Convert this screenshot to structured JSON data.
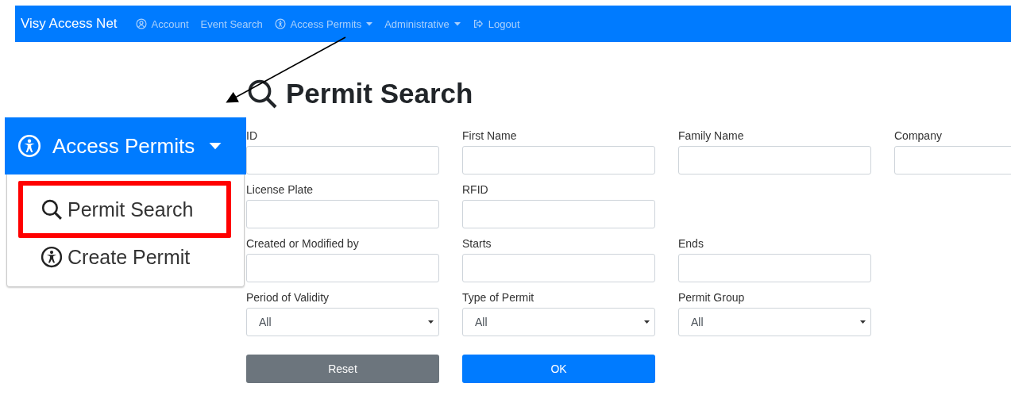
{
  "navbar": {
    "brand": "Visy Access Net",
    "items": [
      {
        "label": "Account",
        "dropdown": false
      },
      {
        "label": "Event Search",
        "dropdown": false
      },
      {
        "label": "Access Permits",
        "dropdown": true
      },
      {
        "label": "Administrative",
        "dropdown": true
      },
      {
        "label": "Logout",
        "dropdown": false
      }
    ]
  },
  "inset": {
    "header": {
      "label": "Access Permits",
      "dropdown": true
    },
    "items": [
      {
        "label": "Permit Search",
        "highlighted": true
      },
      {
        "label": "Create Permit",
        "highlighted": false
      }
    ]
  },
  "page": {
    "title": "Permit Search",
    "rows": [
      [
        {
          "label": "ID",
          "kind": "text"
        },
        {
          "label": "First Name",
          "kind": "text"
        },
        {
          "label": "Family Name",
          "kind": "text"
        },
        {
          "label": "Company",
          "kind": "text"
        }
      ],
      [
        {
          "label": "License Plate",
          "kind": "text"
        },
        {
          "label": "RFID",
          "kind": "text"
        }
      ],
      [
        {
          "label": "Created or Modified by",
          "kind": "text"
        },
        {
          "label": "Starts",
          "kind": "text"
        },
        {
          "label": "Ends",
          "kind": "text"
        }
      ],
      [
        {
          "label": "Period of Validity",
          "kind": "select",
          "value": "All"
        },
        {
          "label": "Type of Permit",
          "kind": "select",
          "value": "All"
        },
        {
          "label": "Permit Group",
          "kind": "select",
          "value": "All"
        }
      ]
    ],
    "buttons": [
      {
        "label": "Reset",
        "kind": "secondary"
      },
      {
        "label": "OK",
        "kind": "primary"
      }
    ]
  }
}
